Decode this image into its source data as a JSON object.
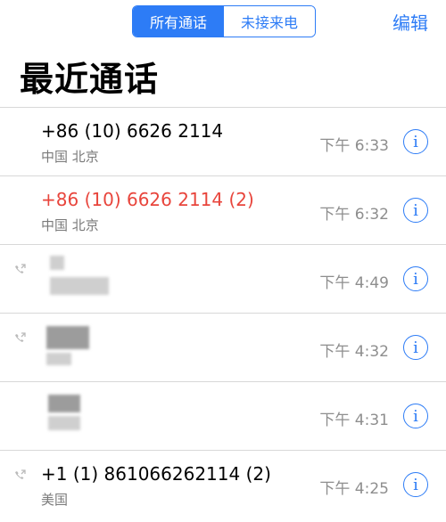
{
  "header": {
    "segments": [
      {
        "label": "所有通话",
        "active": true
      },
      {
        "label": "未接来电",
        "active": false
      }
    ],
    "edit_label": "编辑",
    "title": "最近通话"
  },
  "calls": [
    {
      "name": "+86 (10) 6626 2114",
      "location": "中国 北京",
      "time": "下午 6:33",
      "missed": false,
      "outgoing_icon": false,
      "redacted": false
    },
    {
      "name": "+86 (10) 6626 2114 (2)",
      "location": "中国 北京",
      "time": "下午 6:32",
      "missed": true,
      "outgoing_icon": false,
      "redacted": false
    },
    {
      "name": "",
      "location": "",
      "time": "下午 4:49",
      "missed": false,
      "outgoing_icon": true,
      "redacted": true
    },
    {
      "name": "",
      "location": "",
      "time": "下午 4:32",
      "missed": false,
      "outgoing_icon": true,
      "redacted": true
    },
    {
      "name": "",
      "location": "",
      "time": "下午 4:31",
      "missed": false,
      "outgoing_icon": false,
      "redacted": true
    },
    {
      "name": "+1 (1) 861066262114 (2)",
      "location": "美国",
      "time": "下午 4:25",
      "missed": false,
      "outgoing_icon": true,
      "redacted": false
    }
  ],
  "colors": {
    "accent": "#2d7cf6",
    "missed": "#e8453c",
    "secondary_text": "#8e8e8e"
  },
  "icons": {
    "info": "info-circle-icon",
    "outgoing_call": "outgoing-call-icon"
  }
}
